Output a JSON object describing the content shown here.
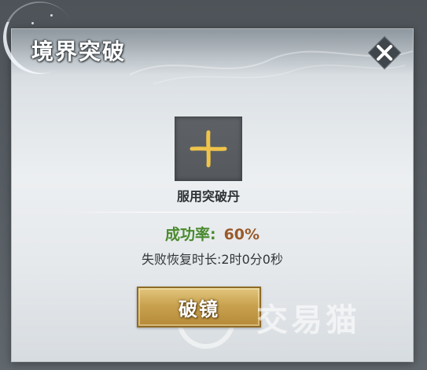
{
  "dialog": {
    "title": "境界突破",
    "close_icon": "close-icon"
  },
  "slot": {
    "icon": "plus-icon",
    "label": "服用突破丹"
  },
  "stats": {
    "rate_label": "成功率:",
    "rate_value": "60%",
    "recover_text": "失败恢复时长:2时0分0秒"
  },
  "actions": {
    "break_label": "破镜"
  },
  "watermark": {
    "text": "交易猫"
  },
  "colors": {
    "rate_label": "#4a8a2e",
    "rate_value": "#9a5a2a",
    "button_gold": "#c9a24f",
    "plus_gold": "#f0c44a"
  }
}
